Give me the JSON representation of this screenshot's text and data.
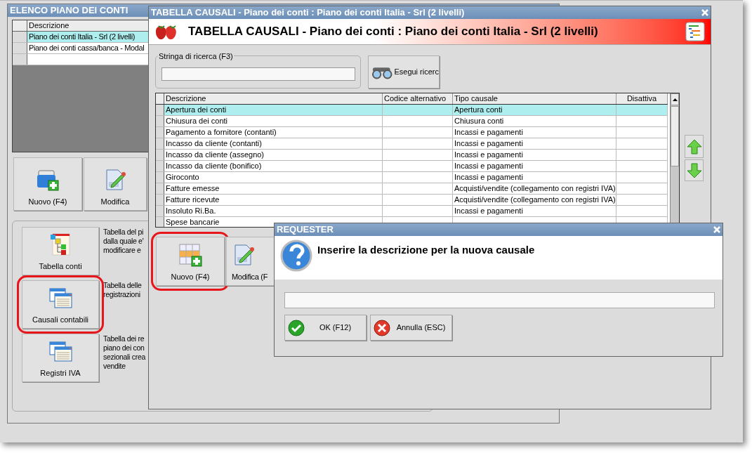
{
  "accounts_window": {
    "title": "ELENCO PIANO DEI CONTI",
    "table": {
      "columns": [
        "Descrizione"
      ],
      "rows": [
        {
          "cells": [
            "Piano dei conti Italia - Srl (2 livelli)"
          ],
          "selected": true
        },
        {
          "cells": [
            "Piano dei conti cassa/banca - Modal"
          ],
          "selected": false
        }
      ]
    },
    "buttons": [
      {
        "label": "Nuovo (F4)",
        "kind": "new"
      },
      {
        "label": "Modifica",
        "kind": "edit"
      }
    ],
    "tables": [
      {
        "label": "Tabella conti",
        "kind": "tree",
        "description": "Tabella del pi\ndalla quale e'\nmodificare e",
        "highlighted": false
      },
      {
        "label": "Causali contabili",
        "kind": "windows",
        "description": "Tabella delle\nregistrazioni",
        "highlighted": true
      },
      {
        "label": "Registri IVA",
        "kind": "windows",
        "description": "Tabella dei re\npiano dei con\nsezionali crea\nvendite",
        "highlighted": false
      }
    ]
  },
  "causali_window": {
    "title": "TABELLA CAUSALI - Piano dei conti : Piano dei conti Italia - Srl (2 livelli)",
    "header": "TABELLA CAUSALI - Piano dei conti : Piano dei conti Italia - Srl (2 livelli)",
    "search": {
      "label": "Stringa di ricerca (F3)",
      "button": "Esegui ricerc"
    },
    "table": {
      "columns": [
        "Descrizione",
        "Codice alternativo",
        "Tipo causale",
        "Disattiva"
      ],
      "rows": [
        {
          "cells": [
            "Apertura dei conti",
            "",
            "Apertura conti",
            ""
          ],
          "selected": true
        },
        {
          "cells": [
            "Chiusura dei conti",
            "",
            "Chiusura conti",
            ""
          ],
          "selected": false
        },
        {
          "cells": [
            "Pagamento a fornitore (contanti)",
            "",
            "Incassi e pagamenti",
            ""
          ],
          "selected": false
        },
        {
          "cells": [
            "Incasso da cliente (contanti)",
            "",
            "Incassi e pagamenti",
            ""
          ],
          "selected": false
        },
        {
          "cells": [
            "Incasso da cliente (assegno)",
            "",
            "Incassi e pagamenti",
            ""
          ],
          "selected": false
        },
        {
          "cells": [
            "Incasso da cliente (bonifico)",
            "",
            "Incassi e pagamenti",
            ""
          ],
          "selected": false
        },
        {
          "cells": [
            "Giroconto",
            "",
            "Incassi e pagamenti",
            ""
          ],
          "selected": false
        },
        {
          "cells": [
            "Fatture emesse",
            "",
            "Acquisti/vendite (collegamento con registri IVA)",
            ""
          ],
          "selected": false
        },
        {
          "cells": [
            "Fatture ricevute",
            "",
            "Acquisti/vendite (collegamento con registri IVA)",
            ""
          ],
          "selected": false
        },
        {
          "cells": [
            "Insoluto Ri.Ba.",
            "",
            "Incassi e pagamenti",
            ""
          ],
          "selected": false
        },
        {
          "cells": [
            "Spese bancarie",
            "",
            "",
            ""
          ],
          "selected": false
        }
      ]
    },
    "buttons": [
      {
        "label": "Nuovo (F4)",
        "kind": "grid",
        "highlighted": true
      },
      {
        "label": "Modifica (F",
        "kind": "edit",
        "highlighted": false
      }
    ]
  },
  "requester": {
    "title": "REQUESTER",
    "prompt": "Inserire la descrizione per la nuova causale",
    "buttons": [
      {
        "label": "OK (F12)",
        "kind": "ok"
      },
      {
        "label": "Annulla (ESC)",
        "kind": "cancel"
      }
    ]
  }
}
